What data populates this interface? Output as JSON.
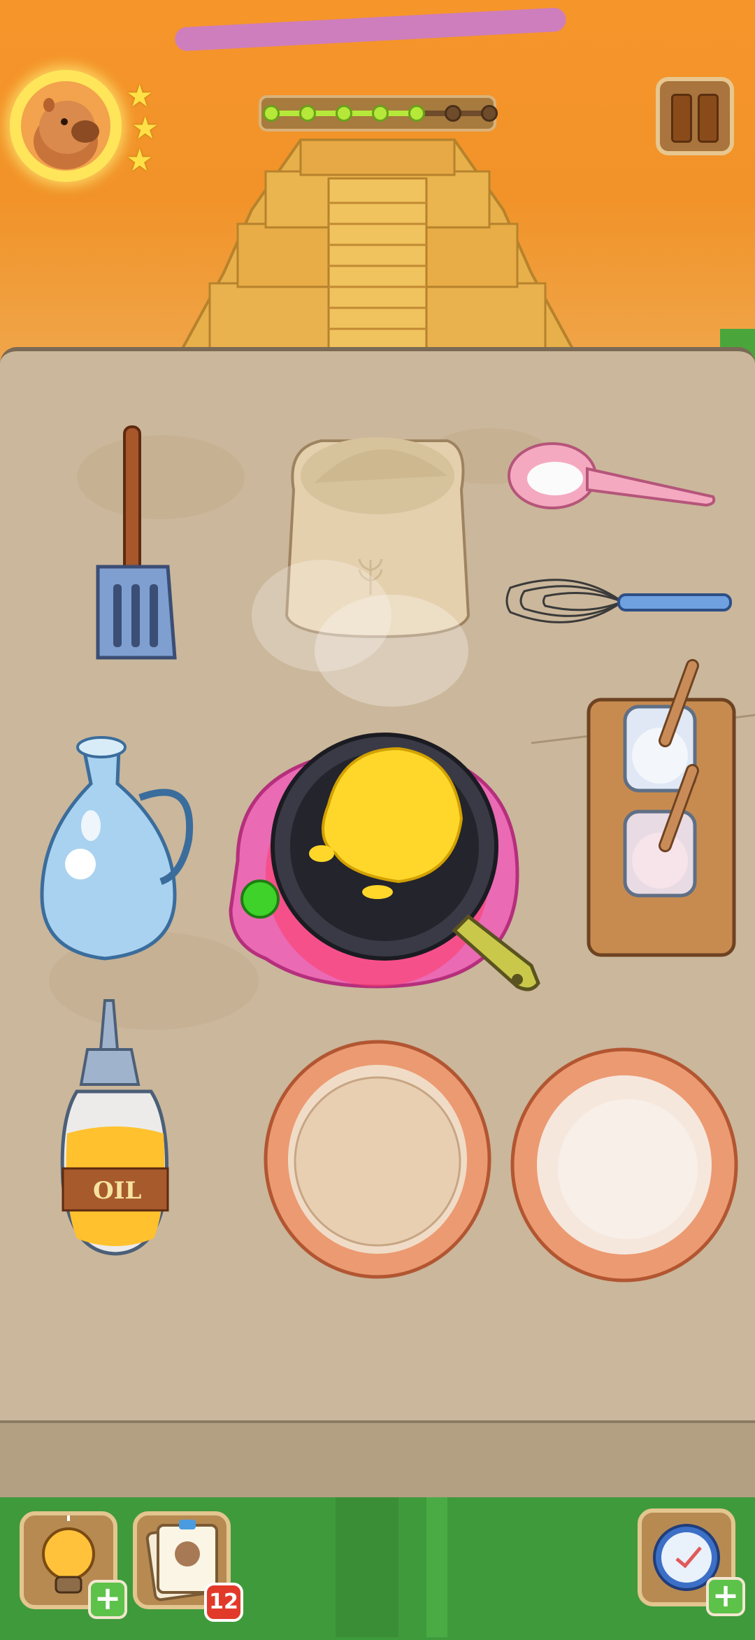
{
  "hud": {
    "avatar_icon": "capybara-chef-avatar",
    "stars": [
      "★",
      "★",
      "★"
    ],
    "stars_earned": 3,
    "progress": {
      "filled_steps": 5,
      "total_steps": 7,
      "fill_color": "#b6e83a",
      "empty_color": "#6e4b2a"
    },
    "pause_icon": "pause-icon"
  },
  "kitchen": {
    "tools": [
      "spatula",
      "flour-sack",
      "measuring-spoon",
      "whisk",
      "water-jug",
      "frying-pan-on-stove",
      "salt-and-sugar-jars",
      "oil-bottle",
      "plate-with-pancake",
      "empty-plate"
    ],
    "oil_label": "OIL",
    "pan_contents": "pancake-batter",
    "stove_indicator_color": "#3ed22a"
  },
  "bottom_bar": {
    "hint_icon": "lightbulb-icon",
    "recipe_icon": "recipe-book-icon",
    "recipe_badge": "12",
    "timer_icon": "clock-icon",
    "plus_label": "+"
  },
  "colors": {
    "sky": "#f6952a",
    "counter": "#cbb79b",
    "grass": "#3f9a3c",
    "accent": "#5dc24a"
  }
}
